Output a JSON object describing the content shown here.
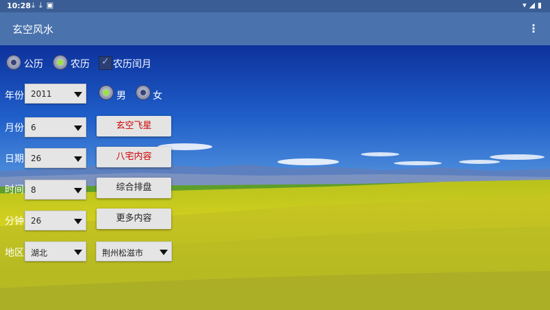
{
  "status": {
    "time": "10:28"
  },
  "app": {
    "title": "玄空风水"
  },
  "calendar": {
    "gregorian": "公历",
    "lunar": "农历",
    "leap": "农历闰月",
    "selected": "lunar"
  },
  "gender": {
    "male": "男",
    "female": "女",
    "selected": "male"
  },
  "fields": {
    "year": {
      "label": "年份",
      "value": "2011"
    },
    "month": {
      "label": "月份",
      "value": "6"
    },
    "day": {
      "label": "日期",
      "value": "26"
    },
    "hour": {
      "label": "时间",
      "value": "8"
    },
    "minute": {
      "label": "分钟",
      "value": "26"
    },
    "region": {
      "label": "地区",
      "value": "湖北",
      "city": "荆州松滋市"
    }
  },
  "buttons": {
    "feixing": "玄空飞星",
    "bazhai": "八宅内容",
    "zonghe": "综合排盘",
    "more": "更多内容"
  },
  "colors": {
    "appbar": "#4a72ad",
    "statusbar": "#3a5d95",
    "red_text": "#d00000",
    "radio_on": "#9be33e"
  }
}
